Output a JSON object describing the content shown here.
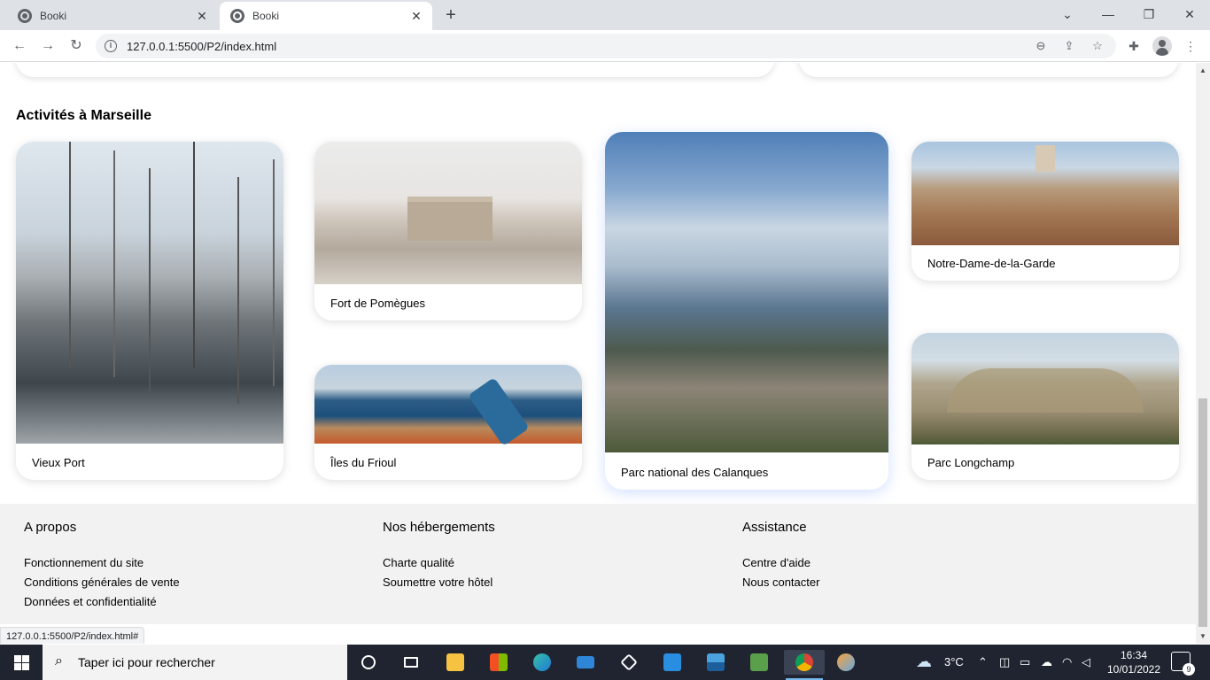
{
  "browser": {
    "tabs": [
      {
        "title": "Booki",
        "active": false
      },
      {
        "title": "Booki",
        "active": true
      }
    ],
    "url": "127.0.0.1:5500/P2/index.html",
    "status_url": "127.0.0.1:5500/P2/index.html#"
  },
  "activities": {
    "title": "Activités à Marseille",
    "cards": [
      {
        "label": "Vieux Port",
        "image": "marina-with-sailboats"
      },
      {
        "label": "Fort de Pomègues",
        "image": "stone-fort-on-rocks"
      },
      {
        "label": "Îles du Frioul",
        "image": "telescope-over-sea"
      },
      {
        "label": "Parc national des Calanques",
        "image": "calanques-cliffs-and-sea"
      },
      {
        "label": "Notre-Dame-de-la-Garde",
        "image": "hilltop-basilica-cityscape"
      },
      {
        "label": "Parc Longchamp",
        "image": "palais-longchamp-colonnade"
      }
    ]
  },
  "footer": {
    "columns": [
      {
        "heading": "A propos",
        "links": [
          "Fonctionnement du site",
          "Conditions générales de vente",
          "Données et confidentialité"
        ]
      },
      {
        "heading": "Nos hébergements",
        "links": [
          "Charte qualité",
          "Soumettre votre hôtel"
        ]
      },
      {
        "heading": "Assistance",
        "links": [
          "Centre d'aide",
          "Nous contacter"
        ]
      }
    ]
  },
  "taskbar": {
    "search_placeholder": "Taper ici pour rechercher",
    "weather": "3°C",
    "time": "16:34",
    "date": "10/01/2022",
    "notification_count": "9"
  }
}
